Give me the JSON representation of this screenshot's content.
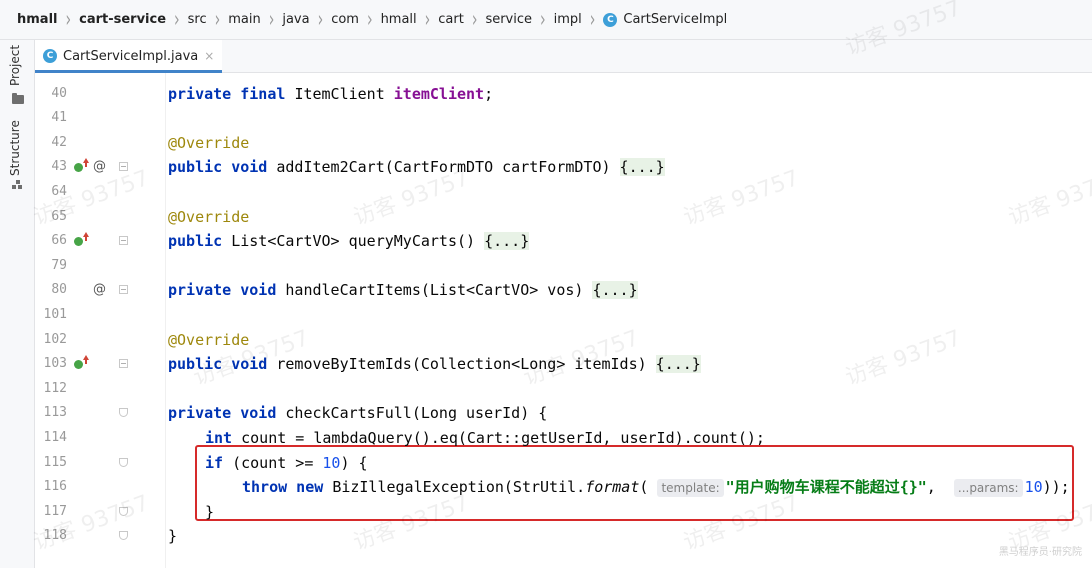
{
  "breadcrumb": [
    "hmall",
    "cart-service",
    "src",
    "main",
    "java",
    "com",
    "hmall",
    "cart",
    "service",
    "impl",
    "CartServiceImpl"
  ],
  "class_icon_letter": "C",
  "side_tools": [
    "Project",
    "Structure"
  ],
  "tab": {
    "label": "CartServiceImpl.java",
    "close": "×"
  },
  "hint_labels": {
    "template": "template:",
    "params": "...params:"
  },
  "lines": [
    {
      "n": "40",
      "tokens": [
        [
          "kw",
          "private final "
        ],
        [
          "",
          "ItemClient "
        ],
        [
          "fld",
          "itemClient"
        ],
        [
          "",
          ";"
        ]
      ]
    },
    {
      "n": "41",
      "tokens": []
    },
    {
      "n": "42",
      "tokens": [
        [
          "ann",
          "@Override"
        ]
      ]
    },
    {
      "n": "43",
      "tokens": [
        [
          "kw",
          "public void "
        ],
        [
          "",
          "addItem2Cart(CartFormDTO cartFormDTO) "
        ],
        [
          "fb",
          "{...}"
        ]
      ]
    },
    {
      "n": "64",
      "tokens": []
    },
    {
      "n": "65",
      "tokens": [
        [
          "ann",
          "@Override"
        ]
      ]
    },
    {
      "n": "66",
      "tokens": [
        [
          "kw",
          "public "
        ],
        [
          "",
          "List<CartVO> queryMyCarts() "
        ],
        [
          "fb",
          "{...}"
        ]
      ]
    },
    {
      "n": "79",
      "tokens": []
    },
    {
      "n": "80",
      "tokens": [
        [
          "kw",
          "private void "
        ],
        [
          "",
          "handleCartItems(List<CartVO> vos) "
        ],
        [
          "fb",
          "{...}"
        ]
      ]
    },
    {
      "n": "101",
      "tokens": []
    },
    {
      "n": "102",
      "tokens": [
        [
          "ann",
          "@Override"
        ]
      ]
    },
    {
      "n": "103",
      "tokens": [
        [
          "kw",
          "public void "
        ],
        [
          "",
          "removeByItemIds(Collection<Long> itemIds) "
        ],
        [
          "fb",
          "{...}"
        ]
      ]
    },
    {
      "n": "112",
      "tokens": []
    },
    {
      "n": "113",
      "tokens": [
        [
          "kw",
          "private void "
        ],
        [
          "",
          "checkCartsFull(Long userId) {"
        ]
      ]
    },
    {
      "n": "114",
      "tokens": [
        [
          "kw",
          "int "
        ],
        [
          "",
          "count = lambdaQuery().eq(Cart::getUserId, userId).count();"
        ]
      ]
    },
    {
      "n": "115",
      "tokens": [
        [
          "kw",
          "if "
        ],
        [
          "",
          "(count >= "
        ],
        [
          "num",
          "10"
        ],
        [
          "",
          ") {"
        ]
      ]
    },
    {
      "n": "116",
      "tokens": [
        [
          "kw",
          "throw new "
        ],
        [
          "",
          "BizIllegalException(StrUtil."
        ],
        [
          "mth",
          "format"
        ],
        [
          "",
          "( "
        ],
        [
          "hint-template",
          ""
        ],
        [
          "str",
          "\"用户购物车课程不能超过{}\""
        ],
        [
          "",
          ",  "
        ],
        [
          "hint-params",
          ""
        ],
        [
          "num",
          "10"
        ],
        [
          "",
          "));"
        ]
      ]
    },
    {
      "n": "117",
      "tokens": [
        [
          "",
          "}"
        ]
      ]
    },
    {
      "n": "118",
      "tokens": [
        [
          "",
          "}"
        ]
      ]
    }
  ],
  "watermark_text": "访客 93757",
  "corner_watermark": "黑马程序员·研究院",
  "colors": {
    "keyword": "#0033b3",
    "field": "#871094",
    "annotation": "#9e880d",
    "number": "#1750eb",
    "string": "#067d17",
    "highlight": "#d62a2a",
    "tab_accent": "#4083c9",
    "class_icon": "#3d9fd8"
  }
}
